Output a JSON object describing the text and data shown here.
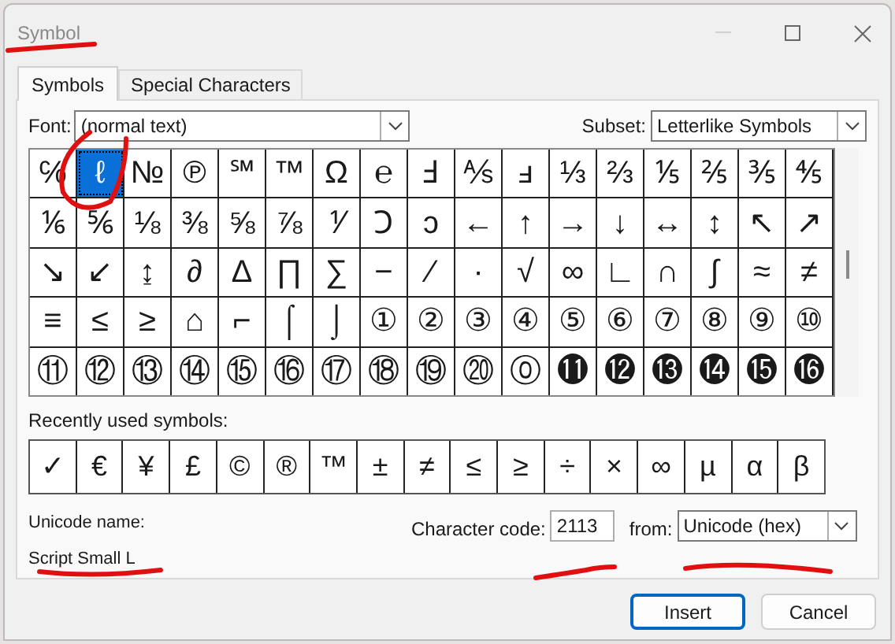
{
  "window": {
    "title": "Symbol"
  },
  "tabs": [
    {
      "label": "Symbols",
      "selected": true
    },
    {
      "label": "Special Characters",
      "selected": false
    }
  ],
  "font": {
    "label": "Font:",
    "value": "(normal text)"
  },
  "subset": {
    "label": "Subset:",
    "value": "Letterlike Symbols"
  },
  "symbol_grid": {
    "rows": [
      [
        {
          "c": "℅",
          "selected": false
        },
        {
          "c": "ℓ",
          "selected": true
        },
        {
          "c": "№",
          "selected": false
        },
        {
          "c": "℗",
          "selected": false
        },
        {
          "c": "℠",
          "selected": false
        },
        {
          "c": "™",
          "selected": false
        },
        {
          "c": "Ω",
          "selected": false
        },
        {
          "c": "℮",
          "selected": false
        },
        {
          "c": "Ⅎ",
          "selected": false
        },
        {
          "c": "⅍",
          "selected": false
        },
        {
          "c": "ⅎ",
          "selected": false
        },
        {
          "c": "⅓",
          "selected": false
        },
        {
          "c": "⅔",
          "selected": false
        },
        {
          "c": "⅕",
          "selected": false
        },
        {
          "c": "⅖",
          "selected": false
        },
        {
          "c": "⅗",
          "selected": false
        },
        {
          "c": "⅘",
          "selected": false
        }
      ],
      [
        {
          "c": "⅙",
          "selected": false
        },
        {
          "c": "⅚",
          "selected": false
        },
        {
          "c": "⅛",
          "selected": false
        },
        {
          "c": "⅜",
          "selected": false
        },
        {
          "c": "⅝",
          "selected": false
        },
        {
          "c": "⅞",
          "selected": false
        },
        {
          "c": "⅟",
          "selected": false
        },
        {
          "c": "Ↄ",
          "selected": false
        },
        {
          "c": "ↄ",
          "selected": false
        },
        {
          "c": "←",
          "selected": false
        },
        {
          "c": "↑",
          "selected": false
        },
        {
          "c": "→",
          "selected": false
        },
        {
          "c": "↓",
          "selected": false
        },
        {
          "c": "↔",
          "selected": false
        },
        {
          "c": "↕",
          "selected": false
        },
        {
          "c": "↖",
          "selected": false
        },
        {
          "c": "↗",
          "selected": false
        }
      ],
      [
        {
          "c": "↘",
          "selected": false
        },
        {
          "c": "↙",
          "selected": false
        },
        {
          "c": "↨",
          "selected": false
        },
        {
          "c": "∂",
          "selected": false
        },
        {
          "c": "∆",
          "selected": false
        },
        {
          "c": "∏",
          "selected": false
        },
        {
          "c": "∑",
          "selected": false
        },
        {
          "c": "−",
          "selected": false
        },
        {
          "c": "∕",
          "selected": false
        },
        {
          "c": "∙",
          "selected": false
        },
        {
          "c": "√",
          "selected": false
        },
        {
          "c": "∞",
          "selected": false
        },
        {
          "c": "∟",
          "selected": false
        },
        {
          "c": "∩",
          "selected": false
        },
        {
          "c": "∫",
          "selected": false
        },
        {
          "c": "≈",
          "selected": false
        },
        {
          "c": "≠",
          "selected": false
        }
      ],
      [
        {
          "c": "≡",
          "selected": false
        },
        {
          "c": "≤",
          "selected": false
        },
        {
          "c": "≥",
          "selected": false
        },
        {
          "c": "⌂",
          "selected": false
        },
        {
          "c": "⌐",
          "selected": false
        },
        {
          "c": "⌠",
          "selected": false
        },
        {
          "c": "⌡",
          "selected": false
        },
        {
          "c": "①",
          "selected": false
        },
        {
          "c": "②",
          "selected": false
        },
        {
          "c": "③",
          "selected": false
        },
        {
          "c": "④",
          "selected": false
        },
        {
          "c": "⑤",
          "selected": false
        },
        {
          "c": "⑥",
          "selected": false
        },
        {
          "c": "⑦",
          "selected": false
        },
        {
          "c": "⑧",
          "selected": false
        },
        {
          "c": "⑨",
          "selected": false
        },
        {
          "c": "⑩",
          "selected": false
        }
      ],
      [
        {
          "c": "⑪",
          "selected": false
        },
        {
          "c": "⑫",
          "selected": false
        },
        {
          "c": "⑬",
          "selected": false
        },
        {
          "c": "⑭",
          "selected": false
        },
        {
          "c": "⑮",
          "selected": false
        },
        {
          "c": "⑯",
          "selected": false
        },
        {
          "c": "⑰",
          "selected": false
        },
        {
          "c": "⑱",
          "selected": false
        },
        {
          "c": "⑲",
          "selected": false
        },
        {
          "c": "⑳",
          "selected": false
        },
        {
          "c": "⓪",
          "selected": false
        },
        {
          "c": "⓫",
          "selected": false
        },
        {
          "c": "⓬",
          "selected": false
        },
        {
          "c": "⓭",
          "selected": false
        },
        {
          "c": "⓮",
          "selected": false
        },
        {
          "c": "⓯",
          "selected": false
        },
        {
          "c": "⓰",
          "selected": false
        }
      ]
    ]
  },
  "recent": {
    "label": "Recently used symbols:",
    "symbols": [
      "✓",
      "€",
      "¥",
      "£",
      "©",
      "®",
      "™",
      "±",
      "≠",
      "≤",
      "≥",
      "÷",
      "×",
      "∞",
      "µ",
      "α",
      "β"
    ]
  },
  "unicode_name": {
    "label": "Unicode name:",
    "value": "Script Small L"
  },
  "character_code": {
    "label": "Character code:",
    "value": "2113"
  },
  "from": {
    "label": "from:",
    "value": "Unicode (hex)"
  },
  "buttons": [
    {
      "label": "Insert",
      "kind": "default"
    },
    {
      "label": "Cancel",
      "kind": "normal"
    }
  ]
}
